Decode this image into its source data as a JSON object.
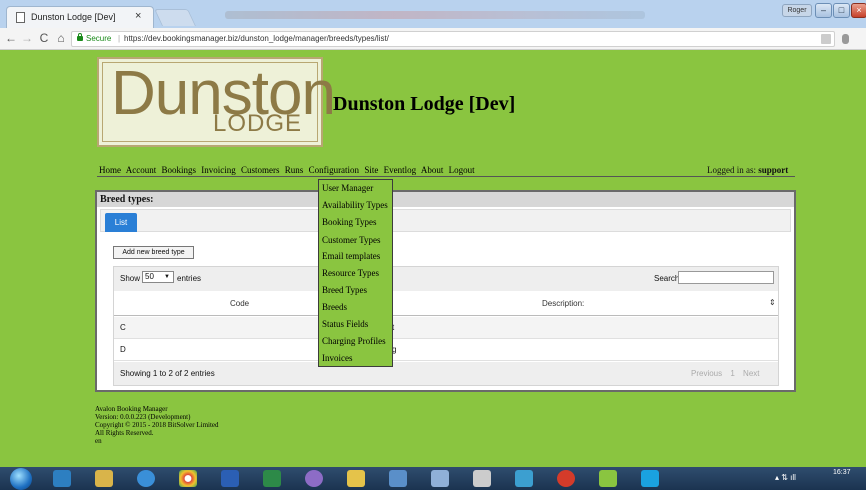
{
  "browser": {
    "tab_title": "Dunston Lodge [Dev]",
    "tab_close": "×",
    "user_label": "Roger",
    "min_glyph": "–",
    "max_glyph": "□",
    "close_glyph": "×",
    "back_glyph": "←",
    "forward_glyph": "→",
    "reload_glyph": "C",
    "home_glyph": "⌂",
    "secure_label": "Secure",
    "url_separator": "|",
    "url": "https://dev.bookingsmanager.biz/dunston_lodge/manager/breeds/types/list/",
    "star_glyph": "☆"
  },
  "logo": {
    "main": "Dunston",
    "sub": "LODGE"
  },
  "site_title": "Dunston Lodge [Dev]",
  "nav": {
    "items": [
      "Home",
      "Account",
      "Bookings",
      "Invoicing",
      "Customers",
      "Runs",
      "Configuration",
      "Site",
      "Eventlog",
      "About",
      "Logout"
    ],
    "logged_in_prefix": "Logged in as:",
    "logged_in_user": "support"
  },
  "config_menu": [
    "User Manager",
    "Availability Types",
    "Booking Types",
    "Customer Types",
    "Email templates",
    "Resource Types",
    "Breed Types",
    "Breeds",
    "Status Fields",
    "Charging Profiles",
    "Invoices"
  ],
  "panel": {
    "title": "Breed types:",
    "tab_label": "List",
    "add_button": "Add new breed type",
    "show_label": "Show",
    "page_length": "50",
    "select_caret": "▼",
    "entries_label": "entries",
    "search_label": "Search:",
    "columns": {
      "code": "Code",
      "description": "Description:"
    },
    "sort_glyph": "⇕",
    "rows": [
      {
        "code": "C",
        "description": "t"
      },
      {
        "code": "D",
        "description": "g"
      }
    ],
    "info": "Showing 1 to 2 of 2 entries",
    "pager": {
      "previous": "Previous",
      "page": "1",
      "next": "Next"
    }
  },
  "footer": {
    "line1": "Avalon Booking Manager",
    "line2": "Version: 0.0.0.223 (Development)",
    "line3": "Copyright © 2015 - 2018 BitSolver Limited",
    "line4": "All Rights Reserved.",
    "line5": "en"
  },
  "taskbar": {
    "time": "16:37"
  },
  "colors": {
    "page_bg": "#8ac540",
    "tab_active": "#2a7fd6",
    "logo_gold": "#8d7a46"
  }
}
